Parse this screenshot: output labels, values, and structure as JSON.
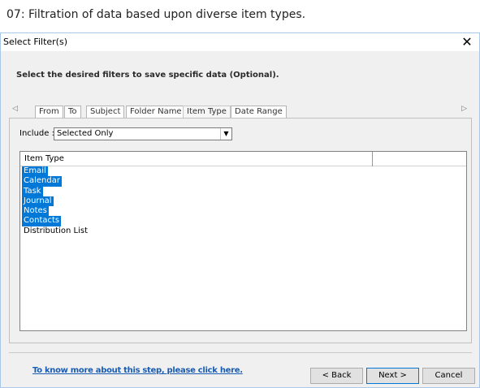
{
  "caption": "07: Filtration of data based upon diverse item types.",
  "dialog": {
    "title": "Select Filter(s)",
    "close_glyph": "✕",
    "instruction": "Select the desired filters to save specific data (Optional)."
  },
  "tabs": {
    "scroll_left": "◁",
    "scroll_right": "▷",
    "items": [
      "From",
      "To",
      "Subject",
      "Folder Name",
      "Item Type",
      "Date Range"
    ],
    "active": "Item Type"
  },
  "include": {
    "label": "Include :",
    "selected": "Selected Only",
    "arrow": "▼"
  },
  "list": {
    "column_header": "Item Type",
    "rows": [
      {
        "label": "Email",
        "selected": true
      },
      {
        "label": "Calendar",
        "selected": true
      },
      {
        "label": "Task",
        "selected": true
      },
      {
        "label": "Journal",
        "selected": true
      },
      {
        "label": "Notes",
        "selected": true
      },
      {
        "label": "Contacts",
        "selected": true
      },
      {
        "label": "Distribution List",
        "selected": false
      }
    ]
  },
  "footer": {
    "help_link": "To know more about this step, please click here.",
    "back_label": "< Back",
    "next_label": "Next >",
    "cancel_label": "Cancel"
  },
  "colors": {
    "selection": "#0078d7",
    "link": "#1a5cb0"
  },
  "icons": {
    "close": "close-icon",
    "dropdown": "chevron-down-icon",
    "tab_scroll_left": "arrow-left-icon",
    "tab_scroll_right": "arrow-right-icon"
  }
}
